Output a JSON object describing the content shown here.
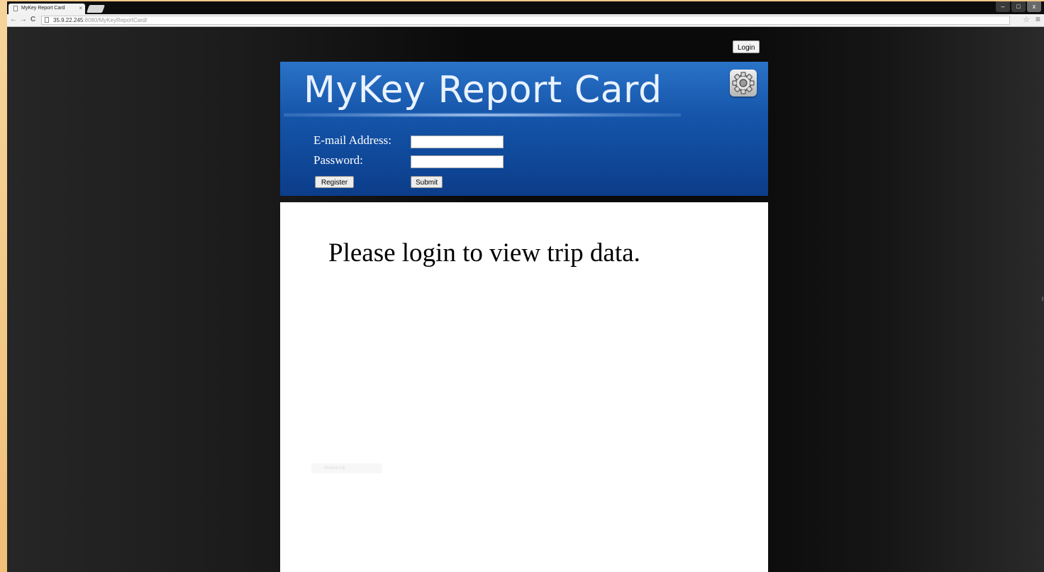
{
  "browser": {
    "tab_title": "MyKey Report Card",
    "tab_close": "×",
    "url_host": "35.9.22.245",
    "url_path": ":8080/MyKeyReportCard/",
    "nav": {
      "back": "←",
      "forward": "→",
      "reload": "C"
    },
    "star": "☆",
    "menu": "≡",
    "window_controls": {
      "minimize": "–",
      "maximize": "□",
      "close": "x"
    }
  },
  "page": {
    "top_login_label": "Login",
    "title": "MyKey Report Card",
    "form": {
      "email_label": "E-mail Address:",
      "email_value": "",
      "password_label": "Password:",
      "password_value": "",
      "register_label": "Register",
      "submit_label": "Submit"
    },
    "message": "Please login to view trip data.",
    "faint_control_label": "Browse trip"
  },
  "colors": {
    "banner_top": "#2a73c8",
    "banner_bottom": "#0b3d8a",
    "background": "#0a0a0a"
  }
}
